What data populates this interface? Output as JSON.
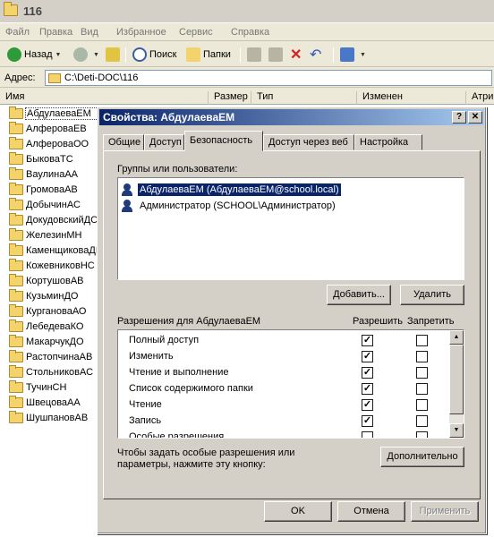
{
  "explorer": {
    "title": "116",
    "menu": [
      "Файл",
      "Правка",
      "Вид",
      "Избранное",
      "Сервис",
      "Справка"
    ],
    "toolbar": {
      "back": "Назад",
      "search": "Поиск",
      "folders": "Папки"
    },
    "address_label": "Адрес:",
    "address_value": "C:\\Deti-DOC\\116",
    "columns": [
      "Имя",
      "Размер",
      "Тип",
      "Изменен",
      "Атри"
    ],
    "folders": [
      "АбдулаеваЕМ",
      "АлфероваЕВ",
      "АлфероваОО",
      "БыковаТС",
      "ВаулинаАА",
      "ГромоваАВ",
      "ДобычинАС",
      "ДокудовскийДС",
      "ЖелезинМН",
      "КаменщиковаДГ",
      "КожевниковНС",
      "КортушовАВ",
      "КузьминДО",
      "КургановаАО",
      "ЛебедеваКО",
      "МакарчукДО",
      "РастопчинаАВ",
      "СтольниковАС",
      "ТучинСН",
      "ШвецоваАА",
      "ШушпановАВ"
    ]
  },
  "dialog": {
    "title": "Свойства: АбдулаеваЕМ",
    "help_btn": "?",
    "close_btn": "✕",
    "tabs": [
      "Общие",
      "Доступ",
      "Безопасность",
      "Доступ через веб",
      "Настройка"
    ],
    "active_tab": "Безопасность",
    "groups_label": "Группы или пользователи:",
    "users": [
      "АбдулаеваЕМ (АбдулаеваЕМ@school.local)",
      "Администратор (SCHOOL\\Администратор)"
    ],
    "add_btn": "Добавить...",
    "remove_btn": "Удалить",
    "perm_label": "Разрешения для АбдулаеваЕМ",
    "allow_col": "Разрешить",
    "deny_col": "Запретить",
    "permissions": [
      {
        "name": "Полный доступ",
        "allow": true,
        "deny": false
      },
      {
        "name": "Изменить",
        "allow": true,
        "deny": false
      },
      {
        "name": "Чтение и выполнение",
        "allow": true,
        "deny": false
      },
      {
        "name": "Список содержимого папки",
        "allow": true,
        "deny": false
      },
      {
        "name": "Чтение",
        "allow": true,
        "deny": false
      },
      {
        "name": "Запись",
        "allow": true,
        "deny": false
      },
      {
        "name": "Особые разрешения",
        "allow": false,
        "deny": false
      }
    ],
    "special_text": "Чтобы задать особые разрешения или параметры, нажмите эту кнопку:",
    "advanced_btn": "Дополнительно",
    "ok_btn": "OK",
    "cancel_btn": "Отмена",
    "apply_btn": "Применить"
  }
}
